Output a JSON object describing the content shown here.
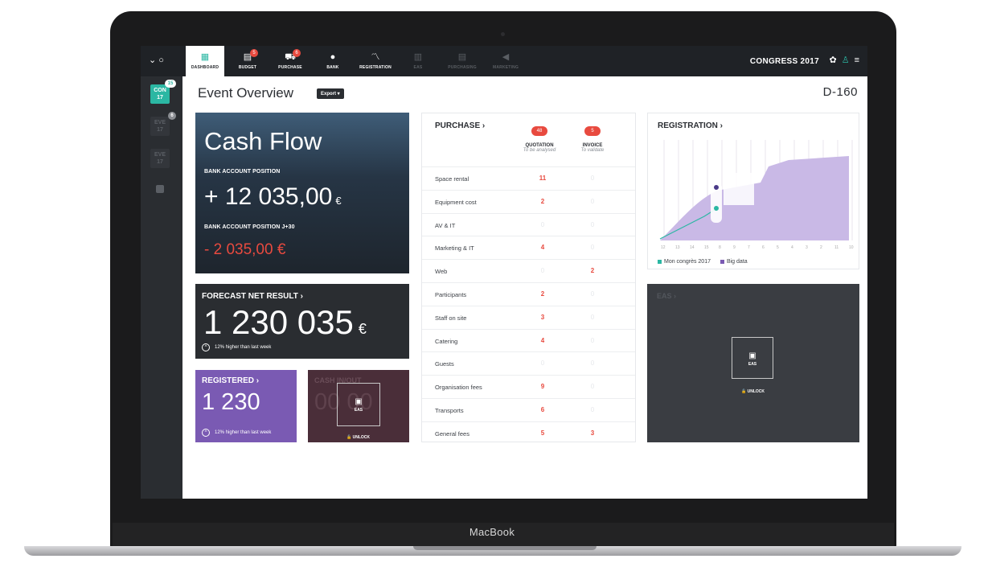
{
  "device": {
    "brand": "MacBook"
  },
  "topbar": {
    "tabs": [
      {
        "label": "DASHBOARD",
        "icon": "dashboard-icon",
        "badge": ""
      },
      {
        "label": "BUDGET",
        "icon": "budget-icon",
        "badge": "5"
      },
      {
        "label": "PURCHASE",
        "icon": "cart-icon",
        "badge": "6"
      },
      {
        "label": "BANK",
        "icon": "bank-icon",
        "badge": ""
      },
      {
        "label": "REGISTRATION",
        "icon": "chart-line-icon",
        "badge": ""
      },
      {
        "label": "EAS",
        "icon": "eas-icon",
        "badge": ""
      },
      {
        "label": "PURCHASING",
        "icon": "purchasing-icon",
        "badge": ""
      },
      {
        "label": "MARKETING",
        "icon": "megaphone-icon",
        "badge": ""
      }
    ],
    "event_name": "CONGRESS 2017"
  },
  "rail": {
    "items": [
      {
        "label": "CON\n17",
        "badge": "15"
      },
      {
        "label": "EVE\n17",
        "badge": "6"
      },
      {
        "label": "EVE\n17",
        "badge": ""
      }
    ]
  },
  "header": {
    "title": "Event Overview",
    "export_label": "Export",
    "countdown": "D-160"
  },
  "cashflow": {
    "title": "Cash Flow",
    "bank_label": "BANK ACCOUNT POSITION",
    "bank_value": "+ 12 035,00",
    "currency": "€",
    "bank30_label": "BANK ACCOUNT POSITION J+30",
    "bank30_value": "- 2 035,00 €"
  },
  "forecast": {
    "title": "FORECAST NET RESULT",
    "value": "1 230 035",
    "currency": "€",
    "note": "12% higher than last week"
  },
  "registered": {
    "title": "REGISTERED",
    "value": "1 230",
    "note": "12% higher than last week"
  },
  "cash_box": {
    "ghost_title": "CASH IN/OUT",
    "ghost_value": "00 00",
    "lock_text": "EAS",
    "unlock": "UNLOCK"
  },
  "purchase": {
    "title": "PURCHASE",
    "quotation": {
      "badge": "48",
      "label": "QUOTATION",
      "sub": "To be analysed"
    },
    "invoice": {
      "badge": "5",
      "label": "INVOICE",
      "sub": "To validate"
    },
    "rows": [
      {
        "name": "Space rental",
        "quotation": "11",
        "invoice": "0"
      },
      {
        "name": "Equipment cost",
        "quotation": "2",
        "invoice": "0"
      },
      {
        "name": "AV & IT",
        "quotation": "0",
        "invoice": "0"
      },
      {
        "name": "Marketing & IT",
        "quotation": "4",
        "invoice": "0"
      },
      {
        "name": "Web",
        "quotation": "0",
        "invoice": "2"
      },
      {
        "name": "Participants",
        "quotation": "2",
        "invoice": "0"
      },
      {
        "name": "Staff on site",
        "quotation": "3",
        "invoice": "0"
      },
      {
        "name": "Catering",
        "quotation": "4",
        "invoice": "0"
      },
      {
        "name": "Guests",
        "quotation": "0",
        "invoice": "0"
      },
      {
        "name": "Organisation fees",
        "quotation": "9",
        "invoice": "0"
      },
      {
        "name": "Transports",
        "quotation": "6",
        "invoice": "0"
      },
      {
        "name": "General fees",
        "quotation": "5",
        "invoice": "3"
      }
    ]
  },
  "registration": {
    "title": "REGISTRATION",
    "legend": [
      "Mon congrès 2017",
      "Big data"
    ],
    "colors": {
      "series1": "#2bb7a3",
      "series2": "#7a5ab3",
      "area": "#c9b9e6"
    }
  },
  "eas": {
    "title": "EAS",
    "lock_text": "EAS",
    "unlock": "UNLOCK"
  },
  "colors": {
    "accent": "#2bb7a3",
    "alert": "#e84a3f",
    "purple": "#7a5ab3",
    "dark": "#2a2d31"
  }
}
